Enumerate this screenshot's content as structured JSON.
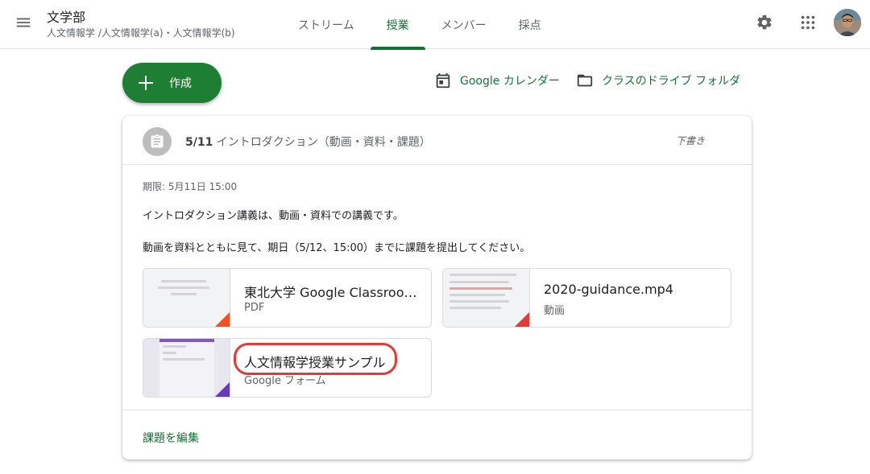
{
  "header": {
    "class_title": "文学部",
    "class_subtitle": "人文情報学 /人文情報学(a)・人文情報学(b)",
    "tabs": [
      {
        "label": "ストリーム",
        "active": false
      },
      {
        "label": "授業",
        "active": true
      },
      {
        "label": "メンバー",
        "active": false
      },
      {
        "label": "採点",
        "active": false
      }
    ],
    "icons": [
      "menu-icon",
      "gear-icon",
      "apps-grid-icon",
      "avatar"
    ]
  },
  "toolbar": {
    "create_label": "作成",
    "calendar_label": "Google カレンダー",
    "drive_label": "クラスのドライブ フォルダ"
  },
  "assignment": {
    "title_date": "5/11",
    "title_text": " イントロダクション（動画・資料・課題）",
    "status": "下書き",
    "due": "期限: 5月11日 15:00",
    "description_1": "イントロダクション講義は、動画・資料での講義です。",
    "description_2": "動画を資料とともに見て、期日（5/12、15:00）までに課題を提出してください。",
    "attachments": [
      {
        "title": "東北大学 Google Classroom 利用ガイド",
        "type": "PDF",
        "corner_color": "#f4511e"
      },
      {
        "title": "2020-guidance.mp4",
        "type": "動画",
        "corner_color": "#e53935"
      },
      {
        "title": "人文情報学授業サンプル",
        "type": "Google フォーム",
        "corner_color": "#673ab7"
      }
    ],
    "edit_label": "課題を編集"
  },
  "colors": {
    "accent": "#137333",
    "create_button": "#1e7e34",
    "highlight": "#e53935"
  }
}
